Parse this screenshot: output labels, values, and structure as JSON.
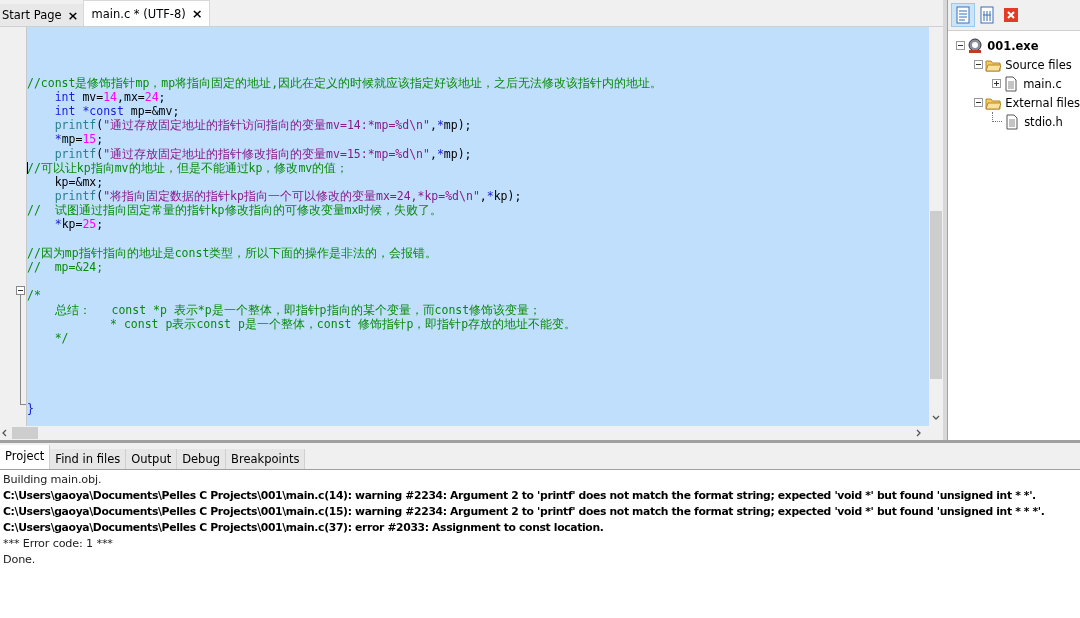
{
  "editor_tabs": [
    {
      "label": "Start Page",
      "selected": false,
      "close": "×"
    },
    {
      "label": "main.c * (UTF-8)",
      "selected": true,
      "close": "×"
    }
  ],
  "code_lines": [
    {
      "kind": "blank"
    },
    {
      "kind": "blank"
    },
    {
      "kind": "blank"
    },
    {
      "kind": "code",
      "tokens": [
        {
          "kind": "comment",
          "text": "//const是修饰指针mp，mp将指向固定的地址,因此在定义的时候就应该指定好该地址，之后无法修改该指针内的地址。"
        }
      ]
    },
    {
      "kind": "code",
      "tokens": [
        {
          "kind": "keyword",
          "text": "    int"
        },
        {
          "kind": "plain",
          "text": " mv="
        },
        {
          "kind": "number",
          "text": "14"
        },
        {
          "kind": "plain",
          "text": ",mx="
        },
        {
          "kind": "number",
          "text": "24"
        },
        {
          "kind": "plain",
          "text": ";"
        }
      ]
    },
    {
      "kind": "code",
      "tokens": [
        {
          "kind": "keyword",
          "text": "    int *const"
        },
        {
          "kind": "plain",
          "text": " mp=&mv;"
        }
      ]
    },
    {
      "kind": "code",
      "tokens": [
        {
          "kind": "function",
          "text": "    printf"
        },
        {
          "kind": "plain",
          "text": "("
        },
        {
          "kind": "string",
          "text": "\"通过存放固定地址的指针访问指向的变量mv=14:*mp=%d\\n\""
        },
        {
          "kind": "plain",
          "text": ","
        },
        {
          "kind": "keyword",
          "text": "*"
        },
        {
          "kind": "plain",
          "text": "mp);"
        }
      ]
    },
    {
      "kind": "code",
      "tokens": [
        {
          "kind": "keyword",
          "text": "    *"
        },
        {
          "kind": "plain",
          "text": "mp="
        },
        {
          "kind": "number",
          "text": "15"
        },
        {
          "kind": "plain",
          "text": ";"
        }
      ]
    },
    {
      "kind": "code",
      "tokens": [
        {
          "kind": "function",
          "text": "    printf"
        },
        {
          "kind": "plain",
          "text": "("
        },
        {
          "kind": "string",
          "text": "\"通过存放固定地址的指针修改指向的变量mv=15:*mp=%d\\n\""
        },
        {
          "kind": "plain",
          "text": ","
        },
        {
          "kind": "keyword",
          "text": "*"
        },
        {
          "kind": "plain",
          "text": "mp);"
        }
      ]
    },
    {
      "kind": "code",
      "cursor": true,
      "tokens": [
        {
          "kind": "comment",
          "text": "//可以让kp指向mv的地址，但是不能通过kp，修改mv的值；"
        }
      ]
    },
    {
      "kind": "code",
      "tokens": [
        {
          "kind": "plain",
          "text": "    kp=&mx;"
        }
      ]
    },
    {
      "kind": "code",
      "tokens": [
        {
          "kind": "function",
          "text": "    printf"
        },
        {
          "kind": "plain",
          "text": "("
        },
        {
          "kind": "string",
          "text": "\"将指向固定数据的指针kp指向一个可以修改的变量mx=24,*kp=%d\\n\""
        },
        {
          "kind": "plain",
          "text": ","
        },
        {
          "kind": "keyword",
          "text": "*"
        },
        {
          "kind": "plain",
          "text": "kp);"
        }
      ]
    },
    {
      "kind": "code",
      "tokens": [
        {
          "kind": "comment",
          "text": "//  试图通过指向固定常量的指针kp修改指向的可修改变量mx时候，失败了。"
        }
      ]
    },
    {
      "kind": "code",
      "tokens": [
        {
          "kind": "keyword",
          "text": "    *"
        },
        {
          "kind": "plain",
          "text": "kp="
        },
        {
          "kind": "number",
          "text": "25"
        },
        {
          "kind": "plain",
          "text": ";"
        }
      ]
    },
    {
      "kind": "blank"
    },
    {
      "kind": "code",
      "tokens": [
        {
          "kind": "comment",
          "text": "//因为mp指针指向的地址是const类型，所以下面的操作是非法的，会报错。"
        }
      ]
    },
    {
      "kind": "code",
      "tokens": [
        {
          "kind": "comment",
          "text": "//  mp=&24;"
        }
      ]
    },
    {
      "kind": "blank"
    },
    {
      "kind": "fold-start",
      "tokens": [
        {
          "kind": "comment",
          "text": "/*"
        }
      ]
    },
    {
      "kind": "code",
      "tokens": [
        {
          "kind": "comment",
          "text": "    总结：   const *p 表示*p是一个整体，即指针p指向的某个变量，而const修饰该变量；"
        }
      ]
    },
    {
      "kind": "code",
      "tokens": [
        {
          "kind": "comment",
          "text": "            * const p表示const p是一个整体，const 修饰指针p，即指针p存放的地址不能变。"
        }
      ]
    },
    {
      "kind": "code",
      "tokens": [
        {
          "kind": "comment",
          "text": "    */"
        }
      ]
    },
    {
      "kind": "blank"
    },
    {
      "kind": "blank"
    },
    {
      "kind": "blank"
    },
    {
      "kind": "blank"
    },
    {
      "kind": "fold-end",
      "tokens": [
        {
          "kind": "keyword",
          "text": "}"
        }
      ]
    }
  ],
  "project_tree": [
    {
      "label": "001.exe",
      "kind": "project",
      "expanded": true,
      "children": [
        {
          "label": "Source files",
          "kind": "folder",
          "expanded": true,
          "children": [
            {
              "label": "main.c",
              "kind": "file",
              "expanded": false
            }
          ]
        },
        {
          "label": "External files",
          "kind": "folder",
          "expanded": true,
          "children": [
            {
              "label": "stdio.h",
              "kind": "file"
            }
          ]
        }
      ]
    }
  ],
  "bottom_tabs": [
    {
      "label": "Project",
      "selected": true
    },
    {
      "label": "Find in files",
      "selected": false
    },
    {
      "label": "Output",
      "selected": false
    },
    {
      "label": "Debug",
      "selected": false
    },
    {
      "label": "Breakpoints",
      "selected": false
    }
  ],
  "output_lines": [
    {
      "text": "Building main.obj.",
      "bold": false
    },
    {
      "text": "C:\\Users\\gaoya\\Documents\\Pelles C Projects\\001\\main.c(14): warning #2234: Argument 2 to 'printf' does not match the format string; expected 'void *' but found 'unsigned int * *'.",
      "bold": true
    },
    {
      "text": "C:\\Users\\gaoya\\Documents\\Pelles C Projects\\001\\main.c(15): warning #2234: Argument 2 to 'printf' does not match the format string; expected 'void *' but found 'unsigned int * * *'.",
      "bold": true
    },
    {
      "text": "C:\\Users\\gaoya\\Documents\\Pelles C Projects\\001\\main.c(37): error #2033: Assignment to const location.",
      "bold": true
    },
    {
      "text": "*** Error code: 1 ***",
      "bold": false
    },
    {
      "text": "Done.",
      "bold": false
    }
  ]
}
